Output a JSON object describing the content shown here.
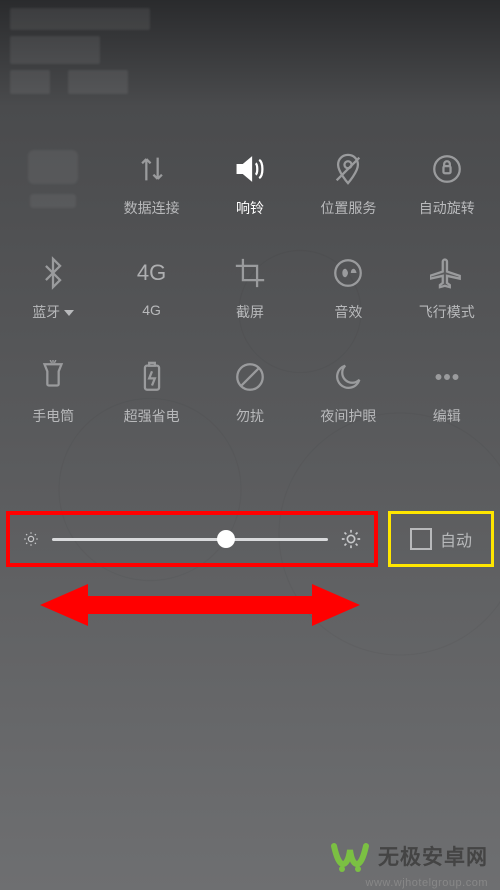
{
  "tiles": {
    "data": "数据连接",
    "ring": "响铃",
    "location": "位置服务",
    "autorotate": "自动旋转",
    "bluetooth": "蓝牙",
    "fourg": "4G",
    "fourg_icon": "4G",
    "screenshot": "截屏",
    "sound_effect": "音效",
    "airplane": "飞行模式",
    "flashlight": "手电筒",
    "powersave": "超强省电",
    "dnd": "勿扰",
    "night": "夜间护眼",
    "edit": "编辑"
  },
  "brightness": {
    "auto_label": "自动",
    "value_percent": 63
  },
  "watermark": {
    "text": "无极安卓网",
    "url": "www.wjhotelgroup.com"
  },
  "annotations": {
    "slider_box_color": "#ff0000",
    "auto_box_color": "#ffe600",
    "arrow_color": "#ff0000"
  }
}
